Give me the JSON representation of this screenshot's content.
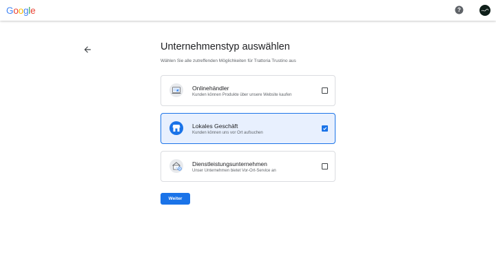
{
  "header": {
    "logo_letters": [
      {
        "char": "G",
        "color": "#4285F4"
      },
      {
        "char": "o",
        "color": "#EA4335"
      },
      {
        "char": "o",
        "color": "#FBBC05"
      },
      {
        "char": "g",
        "color": "#4285F4"
      },
      {
        "char": "l",
        "color": "#34A853"
      },
      {
        "char": "e",
        "color": "#EA4335"
      }
    ],
    "help_icon": "help-circle-icon",
    "avatar_icon": "account-avatar"
  },
  "main": {
    "back_icon": "arrow-back-icon",
    "title": "Unternehmenstyp auswählen",
    "subtitle": "Wählen Sie alle zutreffenden Möglichkeiten für Trattoria Trustino aus",
    "options": [
      {
        "title": "Onlinehändler",
        "description": "Kunden können Produkte über unsere Website kaufen",
        "icon": "online-store-icon",
        "checked": false
      },
      {
        "title": "Lokales Geschäft",
        "description": "Kunden können uns vor Ort aufsuchen",
        "icon": "local-store-icon",
        "checked": true
      },
      {
        "title": "Dienstleistungsunternehmen",
        "description": "Unser Unternehmen bietet Vor-Ort-Service an",
        "icon": "service-business-icon",
        "checked": false
      }
    ],
    "next_button": "Weiter"
  },
  "colors": {
    "accent": "#1a73e8",
    "selected_bg": "#e8f0fe",
    "border": "#dadce0"
  }
}
